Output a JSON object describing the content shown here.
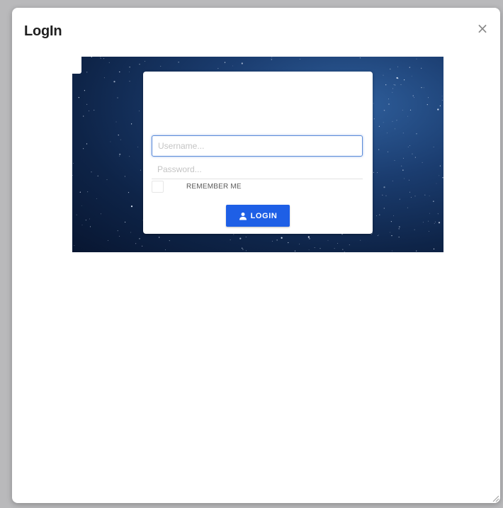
{
  "dialog": {
    "title": "LogIn",
    "close_label": "×"
  },
  "login_form": {
    "username_placeholder": "Username...",
    "username_value": "",
    "password_placeholder": "Password...",
    "password_value": "",
    "remember_label": "REMEMBER ME",
    "remember_checked": false,
    "login_button_label": "LOGIN",
    "login_button_icon": "user-icon"
  },
  "colors": {
    "accent": "#1e5fe6",
    "focus_border": "#5b8bd9",
    "background_sky": "#0e2448"
  }
}
